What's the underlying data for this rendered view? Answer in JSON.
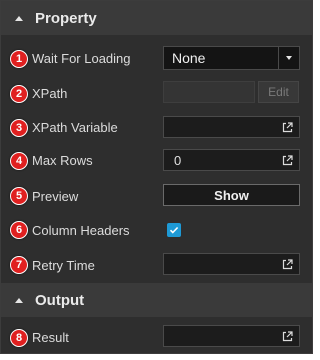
{
  "colors": {
    "panel_bg": "#2e2e2e",
    "header_bg": "#3a3a3a",
    "field_bg": "#1c1c1c",
    "badge_red": "#e02020",
    "checkbox_blue": "#1e9ad6"
  },
  "sections": {
    "property": {
      "title": "Property"
    },
    "output": {
      "title": "Output"
    }
  },
  "fields": {
    "wait_for_loading": {
      "badge": "1",
      "label": "Wait For Loading",
      "value": "None"
    },
    "xpath": {
      "badge": "2",
      "label": "XPath",
      "value": "",
      "edit_label": "Edit"
    },
    "xpath_variable": {
      "badge": "3",
      "label": "XPath Variable",
      "value": "",
      "icon": "external-link-icon"
    },
    "max_rows": {
      "badge": "4",
      "label": "Max Rows",
      "value": "0",
      "icon": "external-link-icon"
    },
    "preview": {
      "badge": "5",
      "label": "Preview",
      "button_label": "Show"
    },
    "column_headers": {
      "badge": "6",
      "label": "Column Headers",
      "checked": true
    },
    "retry_time": {
      "badge": "7",
      "label": "Retry Time",
      "value": "",
      "icon": "external-link-icon"
    },
    "result": {
      "badge": "8",
      "label": "Result",
      "value": "",
      "icon": "external-link-icon"
    }
  }
}
